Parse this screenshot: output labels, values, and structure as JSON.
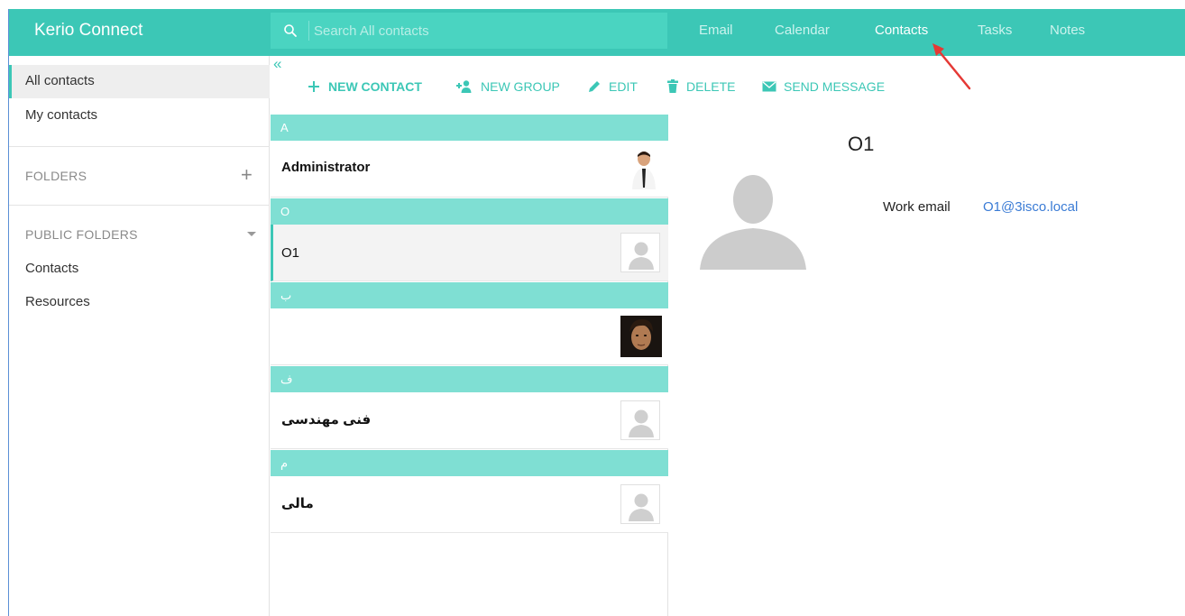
{
  "app": {
    "title": "Kerio Connect"
  },
  "search": {
    "placeholder": "Search All contacts"
  },
  "nav": {
    "email": "Email",
    "calendar": "Calendar",
    "contacts": "Contacts",
    "tasks": "Tasks",
    "notes": "Notes",
    "active": "Contacts"
  },
  "sidebar": {
    "all_contacts": "All contacts",
    "my_contacts": "My contacts",
    "folders_header": "FOLDERS",
    "public_folders_header": "PUBLIC FOLDERS",
    "public_items": [
      "Contacts",
      "Resources"
    ]
  },
  "toolbar": {
    "collapse_icon": "«",
    "new_contact": "NEW CONTACT",
    "new_group": "NEW GROUP",
    "edit": "EDIT",
    "delete": "DELETE",
    "send_message": "SEND MESSAGE"
  },
  "contacts": {
    "groups": [
      {
        "letter": "A",
        "name": "Administrator",
        "avatar": "photo-man-suit"
      },
      {
        "letter": "O",
        "name": "O1",
        "avatar": "placeholder",
        "selected": true
      },
      {
        "letter": "ب",
        "name": "",
        "avatar": "photo-man-dark"
      },
      {
        "letter": "ف",
        "name": "فنی مهندسی",
        "avatar": "placeholder"
      },
      {
        "letter": "م",
        "name": "مالی",
        "avatar": "placeholder"
      }
    ]
  },
  "detail": {
    "title": "O1",
    "work_email_label": "Work email",
    "work_email_value": "O1@3isco.local"
  },
  "colors": {
    "accent": "#3cc7b6",
    "group_header": "#7fdfd3",
    "link": "#3a7bd5",
    "annotation_arrow": "#e53935"
  }
}
